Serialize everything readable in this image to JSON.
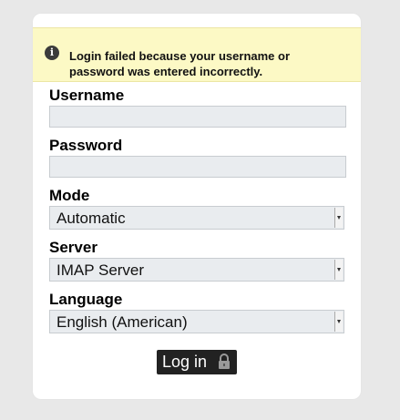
{
  "alert": {
    "icon": "info-icon",
    "glyph": "i",
    "message": "Login failed because your username or password was entered incorrectly."
  },
  "form": {
    "username": {
      "label": "Username",
      "value": ""
    },
    "password": {
      "label": "Password",
      "value": ""
    },
    "mode": {
      "label": "Mode",
      "value": "Automatic"
    },
    "server": {
      "label": "Server",
      "value": "IMAP Server"
    },
    "language": {
      "label": "Language",
      "value": "English (American)"
    }
  },
  "submit": {
    "label": "Log in",
    "icon": "lock-icon"
  },
  "colors": {
    "alert_background": "#fcf9c5",
    "input_background": "#e9ecef",
    "button_background": "#222222"
  }
}
